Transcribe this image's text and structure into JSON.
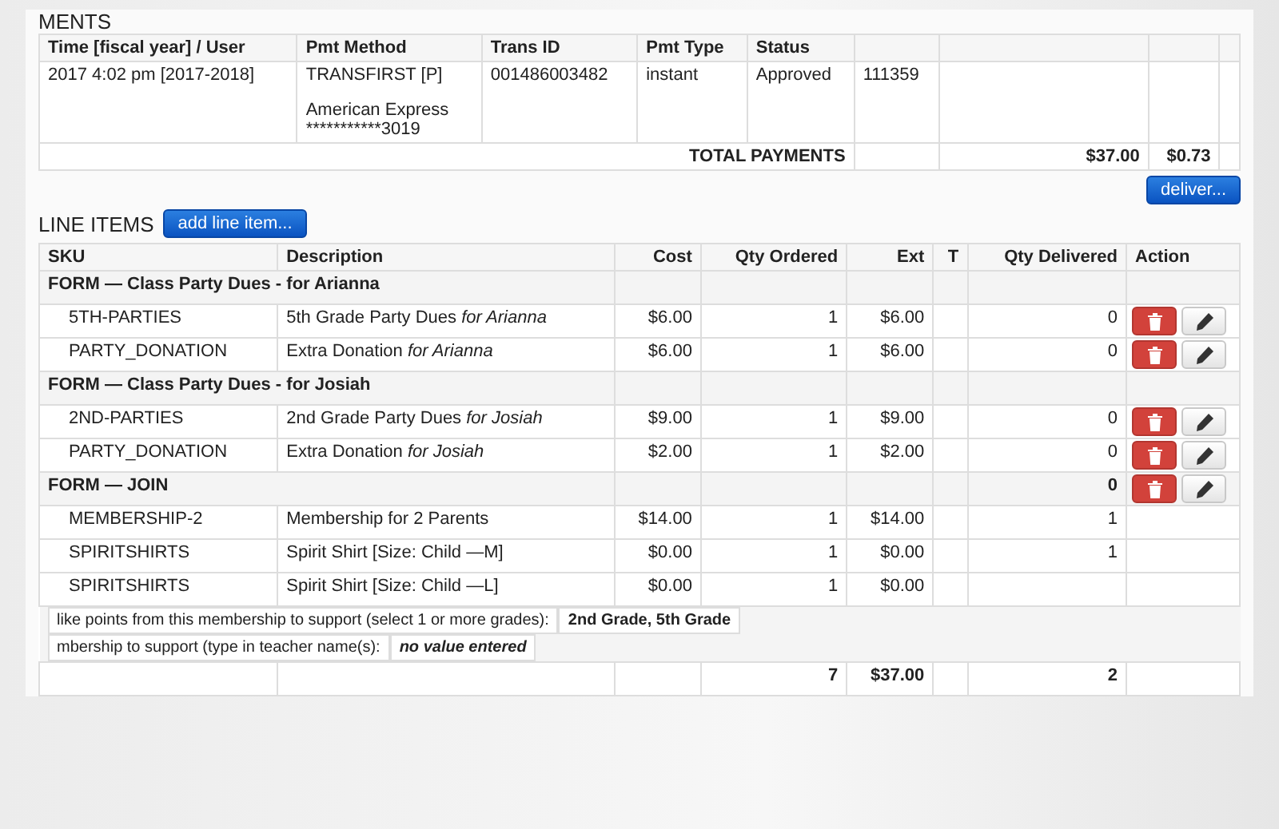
{
  "payments": {
    "heading": "MENTS",
    "columns": [
      "Time [fiscal year] / User",
      "Pmt Method",
      "Trans ID",
      "Pmt Type",
      "Status"
    ],
    "rows": [
      {
        "time": "2017 4:02 pm [2017-2018]",
        "method_lines": [
          "TRANSFIRST [P]",
          "American Express",
          "***********3019"
        ],
        "trans_id": "001486003482",
        "type": "instant",
        "status": "Approved",
        "column_6": "111359"
      }
    ],
    "total": {
      "label": "TOTAL PAYMENTS",
      "amount": "$37.00",
      "fee": "$0.73"
    },
    "deliver_button": "deliver..."
  },
  "line_items": {
    "heading": "LINE ITEMS",
    "add_button": "add line item...",
    "columns": [
      "SKU",
      "Description",
      "Cost",
      "Qty Ordered",
      "Ext",
      "T",
      "Qty Delivered",
      "Action"
    ],
    "rows": [
      {
        "kind": "group",
        "title": "FORM — Class Party Dues - for Arianna",
        "qty_delivered": "",
        "actions": false
      },
      {
        "kind": "item",
        "sku": "5TH-PARTIES",
        "description": "5th Grade Party Dues *for Arianna*",
        "cost": "$6.00",
        "qty": "1",
        "ext": "$6.00",
        "qty_delivered": "0",
        "actions": true
      },
      {
        "kind": "item",
        "sku": "PARTY_DONATION",
        "description": "Extra Donation *for Arianna*",
        "cost": "$6.00",
        "qty": "1",
        "ext": "$6.00",
        "qty_delivered": "0",
        "actions": true
      },
      {
        "kind": "group",
        "title": "FORM — Class Party Dues - for Josiah",
        "qty_delivered": "",
        "actions": false
      },
      {
        "kind": "item",
        "sku": "2ND-PARTIES",
        "description": "2nd Grade Party Dues *for Josiah*",
        "cost": "$9.00",
        "qty": "1",
        "ext": "$9.00",
        "qty_delivered": "0",
        "actions": true
      },
      {
        "kind": "item",
        "sku": "PARTY_DONATION",
        "description": "Extra Donation *for Josiah*",
        "cost": "$2.00",
        "qty": "1",
        "ext": "$2.00",
        "qty_delivered": "0",
        "actions": true
      },
      {
        "kind": "group",
        "title": "FORM — JOIN",
        "qty_delivered": "0",
        "actions": true
      },
      {
        "kind": "item",
        "sku": "MEMBERSHIP-2",
        "description": "Membership for 2 Parents",
        "cost": "$14.00",
        "qty": "1",
        "ext": "$14.00",
        "qty_delivered": "1",
        "actions": false
      },
      {
        "kind": "item",
        "sku": "SPIRITSHIRTS",
        "description": "Spirit Shirt [Size: Child —M]",
        "cost": "$0.00",
        "qty": "1",
        "ext": "$0.00",
        "qty_delivered": "1",
        "actions": false
      },
      {
        "kind": "item",
        "sku": "SPIRITSHIRTS",
        "description": "Spirit Shirt [Size: Child —L]",
        "cost": "$0.00",
        "qty": "1",
        "ext": "$0.00",
        "qty_delivered": "",
        "actions": false
      }
    ],
    "questions": [
      {
        "prompt": "like points from this membership to support (select 1 or more grades):",
        "answer": "2nd Grade, 5th Grade",
        "kind": "value"
      },
      {
        "prompt": "mbership to support (type in teacher name(s):",
        "answer": "no value entered",
        "kind": "none"
      }
    ],
    "totals": {
      "qty_ordered": "7",
      "ext": "$37.00",
      "qty_delivered": "2"
    }
  }
}
